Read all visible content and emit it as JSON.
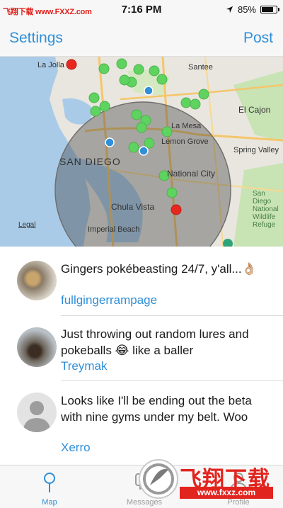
{
  "status_bar": {
    "watermark": "飞翔下载 www.FXXZ.com",
    "time": "7:16 PM",
    "battery_text": "85%",
    "battery_level": 0.85
  },
  "nav": {
    "left_button": "Settings",
    "right_button": "Post"
  },
  "map": {
    "labels": {
      "la_jolla": "La Jolla",
      "santee": "Santee",
      "el_cajon": "El Cajon",
      "la_mesa": "La Mesa",
      "lemon_grove": "Lemon Grove",
      "spring_valley": "Spring Valley",
      "san_diego": "SAN DIEGO",
      "national_city": "National City",
      "chula_vista": "Chula Vista",
      "imperial_beach": "Imperial Beach",
      "refuge": "San Diego National Wildlife Refuge",
      "legal": "Legal"
    },
    "colors": {
      "land": "#e9e6df",
      "water": "#a9cbe8",
      "park": "#c8e3b4",
      "pin_green": "#5fd35f",
      "pin_red": "#e8281f"
    }
  },
  "feed": {
    "posts": [
      {
        "text": "Gingers pokébeasting 24/7, y'all...👌🏼",
        "user": "fullgingerrampage"
      },
      {
        "text": "Just throwing out random lures and pokeballs 😂 like a baller",
        "user": "Treymak"
      },
      {
        "text": "Looks like I'll be ending out the beta with nine gyms under my belt. Woo",
        "user": "Xerro"
      }
    ]
  },
  "tabs": [
    {
      "label": "Map",
      "icon": "map-pin-icon",
      "active": true
    },
    {
      "label": "Messages",
      "icon": "messages-icon",
      "active": false
    },
    {
      "label": "Profile",
      "icon": "profile-icon",
      "active": false
    }
  ],
  "watermark_logo": {
    "title": "飞翔下载",
    "url": "www.fxxz.com"
  }
}
